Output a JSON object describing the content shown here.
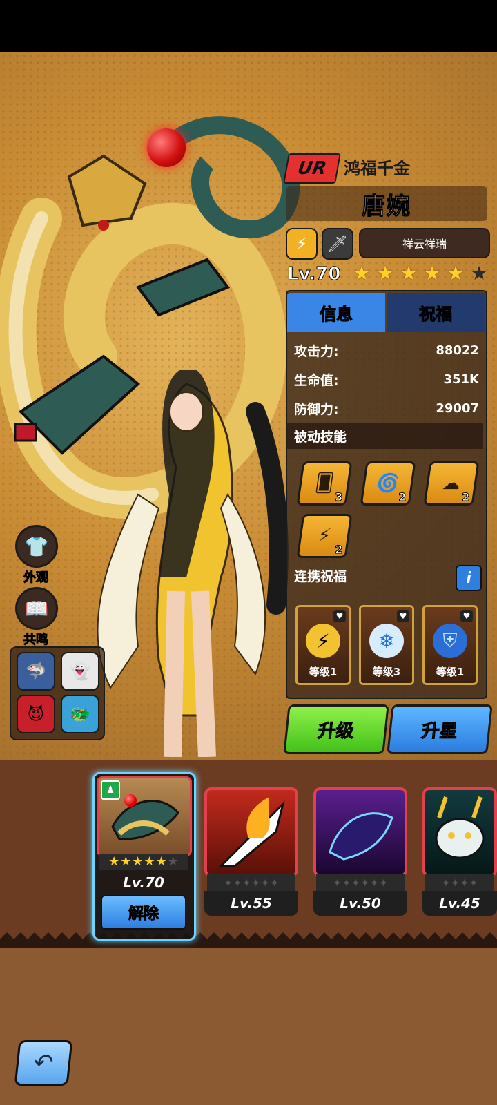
{
  "hero": {
    "rarity": "UR",
    "title": "鸿福千金",
    "name": "唐婉",
    "trait": "祥云祥瑞",
    "level": "Lv.70",
    "stars_total": 6,
    "stars_filled": 5
  },
  "tabs": {
    "info": "信息",
    "bless": "祝福"
  },
  "stats": [
    {
      "label": "攻击力:",
      "value": "88022"
    },
    {
      "label": "生命值:",
      "value": "351K"
    },
    {
      "label": "防御力:",
      "value": "29007"
    }
  ],
  "passive": {
    "header": "被动技能",
    "skills": [
      {
        "icon": "cards-icon",
        "count": "3"
      },
      {
        "icon": "wind-swirl-icon",
        "count": "2"
      },
      {
        "icon": "cloud-icon",
        "count": "2"
      },
      {
        "icon": "crack-icon",
        "count": "2"
      }
    ]
  },
  "bond": {
    "header": "连携祝福",
    "info": "i",
    "cards": [
      {
        "label": "等级1",
        "icon": "lightning-creature-icon",
        "color": "#f2c231"
      },
      {
        "label": "等级3",
        "icon": "snowflake-swirl-icon",
        "color": "#d8ecff"
      },
      {
        "label": "等级1",
        "icon": "blue-shield-icon",
        "color": "#2b6fd6"
      }
    ]
  },
  "actions": {
    "upgrade": "升级",
    "star_up": "升星"
  },
  "side": {
    "appearance": "外观",
    "resonance": "共鸣"
  },
  "equipment": {
    "selected": {
      "level": "Lv.70",
      "stars_filled": 5,
      "stars_total": 6,
      "release": "解除"
    },
    "others": [
      {
        "level": "Lv.55",
        "color": "#c22a1d"
      },
      {
        "level": "Lv.50",
        "color": "#5a1f8e"
      },
      {
        "level": "Lv.45",
        "color": "#123a3e"
      }
    ]
  },
  "colors": {
    "accent_blue": "#3a86e6",
    "accent_green": "#43c11a",
    "rarity_red": "#e53030"
  }
}
